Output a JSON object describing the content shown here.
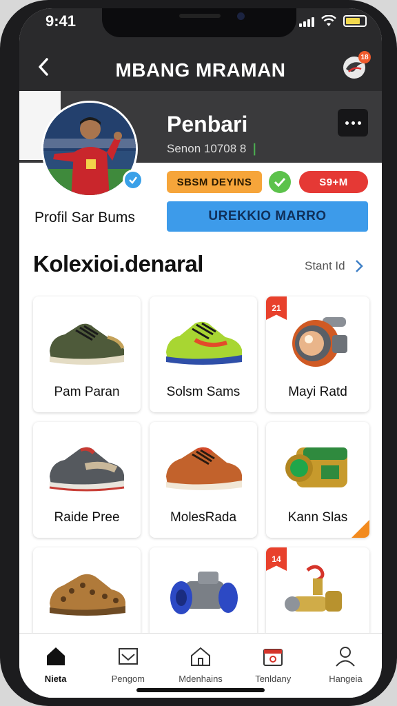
{
  "status_bar": {
    "time": "9:41"
  },
  "header": {
    "title": "MBANG MRAMAN",
    "logo_badge": "18"
  },
  "profile": {
    "name": "Penbari",
    "meta": "Senon 10708 8",
    "caption": "Profil Sar Bums",
    "chip_primary": "SBSM DEYINS",
    "chip_secondary": "S9+M",
    "action_button": "UREKKIO MARRO"
  },
  "collection": {
    "title": "Kolexioi.denaral",
    "link_label": "Stant Id",
    "items": [
      {
        "label": "Pam Paran",
        "icon": "sneaker-olive-icon"
      },
      {
        "label": "Solsm Sams",
        "icon": "sneaker-green-icon"
      },
      {
        "label": "Mayi Ratd",
        "icon": "gadget-orb-icon",
        "badge": "21"
      },
      {
        "label": "Raide Pree",
        "icon": "sneaker-gray-red-icon"
      },
      {
        "label": "MolesRada",
        "icon": "sneaker-orange-icon"
      },
      {
        "label": "Kann Slas",
        "icon": "gold-capsule-icon",
        "corner": true
      },
      {
        "label": "",
        "icon": "leopard-shoe-icon"
      },
      {
        "label": "",
        "icon": "blue-roller-icon"
      },
      {
        "label": "",
        "icon": "gold-valve-icon",
        "badge": "14"
      }
    ]
  },
  "bottom_nav": [
    {
      "label": "Nieta",
      "icon": "home-icon",
      "active": true
    },
    {
      "label": "Pengom",
      "icon": "inbox-icon"
    },
    {
      "label": "Mdenhains",
      "icon": "house-outline-icon"
    },
    {
      "label": "Tenldany",
      "icon": "calendar-icon"
    },
    {
      "label": "Hangeia",
      "icon": "user-icon"
    }
  ],
  "colors": {
    "header_bg": "#2a2a2c",
    "chip_orange": "#f6a53a",
    "chip_red": "#e53935",
    "primary_button": "#3d9bea",
    "badge_red": "#e8412c"
  }
}
